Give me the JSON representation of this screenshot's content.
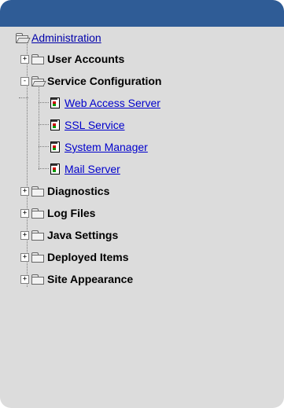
{
  "tree": {
    "root": {
      "label": "Administration",
      "icon": "folder-open-icon"
    },
    "items": [
      {
        "label": "User Accounts",
        "toggle": "+",
        "icon": "folder-icon"
      },
      {
        "label": "Service Configuration",
        "toggle": "-",
        "icon": "folder-open-icon",
        "children": [
          {
            "label": " Web Access Server",
            "icon": "page-icon"
          },
          {
            "label": " SSL Service",
            "icon": "page-icon"
          },
          {
            "label": " System Manager",
            "icon": "page-icon"
          },
          {
            "label": " Mail Server",
            "icon": "page-icon"
          }
        ]
      },
      {
        "label": "Diagnostics",
        "toggle": "+",
        "icon": "folder-icon"
      },
      {
        "label": "Log Files",
        "toggle": "+",
        "icon": "folder-icon"
      },
      {
        "label": "Java Settings",
        "toggle": "+",
        "icon": "folder-icon"
      },
      {
        "label": "Deployed Items",
        "toggle": "+",
        "icon": "folder-icon"
      },
      {
        "label": "Site Appearance",
        "toggle": "+",
        "icon": "folder-icon"
      }
    ]
  },
  "colors": {
    "header": "#2f5c96",
    "panel": "#dcdcdc",
    "link": "#0000cc"
  }
}
